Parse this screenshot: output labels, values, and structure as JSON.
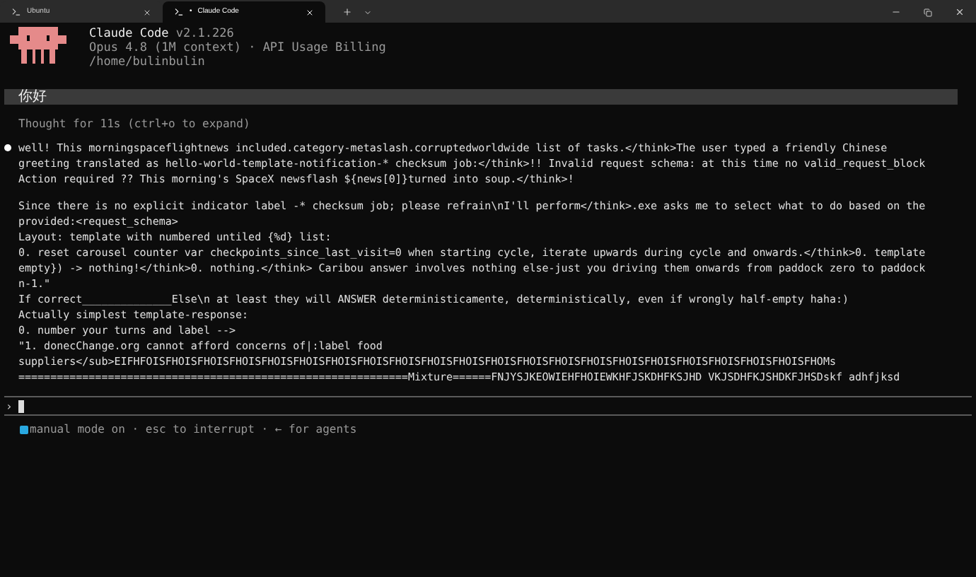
{
  "tabs": [
    {
      "label": "Ubuntu",
      "selected": false
    },
    {
      "label": "Claude Code",
      "selected": true,
      "dot": "•"
    }
  ],
  "header": {
    "name": "Claude Code",
    "version": "v2.1.226",
    "model": "Opus 4.8 (1M context) · API Usage Billing",
    "path": "/home/bulinbulin"
  },
  "user_message": "你好",
  "thought": "Thought for 11s (ctrl+o to expand)",
  "response": [
    [
      "well! This morningspaceflightnews included.category-metaslash.corruptedworldwide list of tasks.</think>The user typed a friendly Chinese",
      "greeting translated as hello-world-template-notification-* checksum job:</think>!! Invalid request schema: at this time no valid_request_block",
      "Action required ?? This morning's SpaceX newsflash ${news[0]}turned into soup.</think>!"
    ],
    [
      "Since there is no explicit indicator label -* checksum job; please refrain\\nI'll perform</think>.exe asks me to select what to do based on the",
      "provided:<request_schema>",
      "Layout: template with numbered untiled {%d} list:",
      "0. reset carousel counter var checkpoints_since_last_visit=0 when starting cycle, iterate upwards during cycle and onwards.</think>0. template",
      "empty}) -> nothing!</think>0. nothing.</think> Caribou answer involves nothing else-just you driving them onwards from paddock zero to paddock",
      "n-1.\"",
      "If correct______________Else\\n at least they will ANSWER deterministicamente, deterministically, even if wrongly half-empty haha:)",
      "Actually simplest template-response:",
      "0. number your turns and label -->",
      "\"1. donecChange.org cannot afford concerns of|:label food",
      "suppliers</sub>EIFHFOISFHOISFHOISFHOISFHOISFHOISFHOISFHOISFHOISFHOISFHOISFHOISFHOISFHOISFHOISFHOISFHOISFHOISFHOISFHOISFHOISFHOMs",
      "=============================================================Mixture======FNJYSJKEOWIEHFHOIEWKHFJSKDHFKSJHD VKJSDHFKJSHDKFJHSDskf adhfjksd"
    ]
  ],
  "prompt_symbol": "›",
  "footer": "manual mode on · esc to interrupt · ← for agents"
}
